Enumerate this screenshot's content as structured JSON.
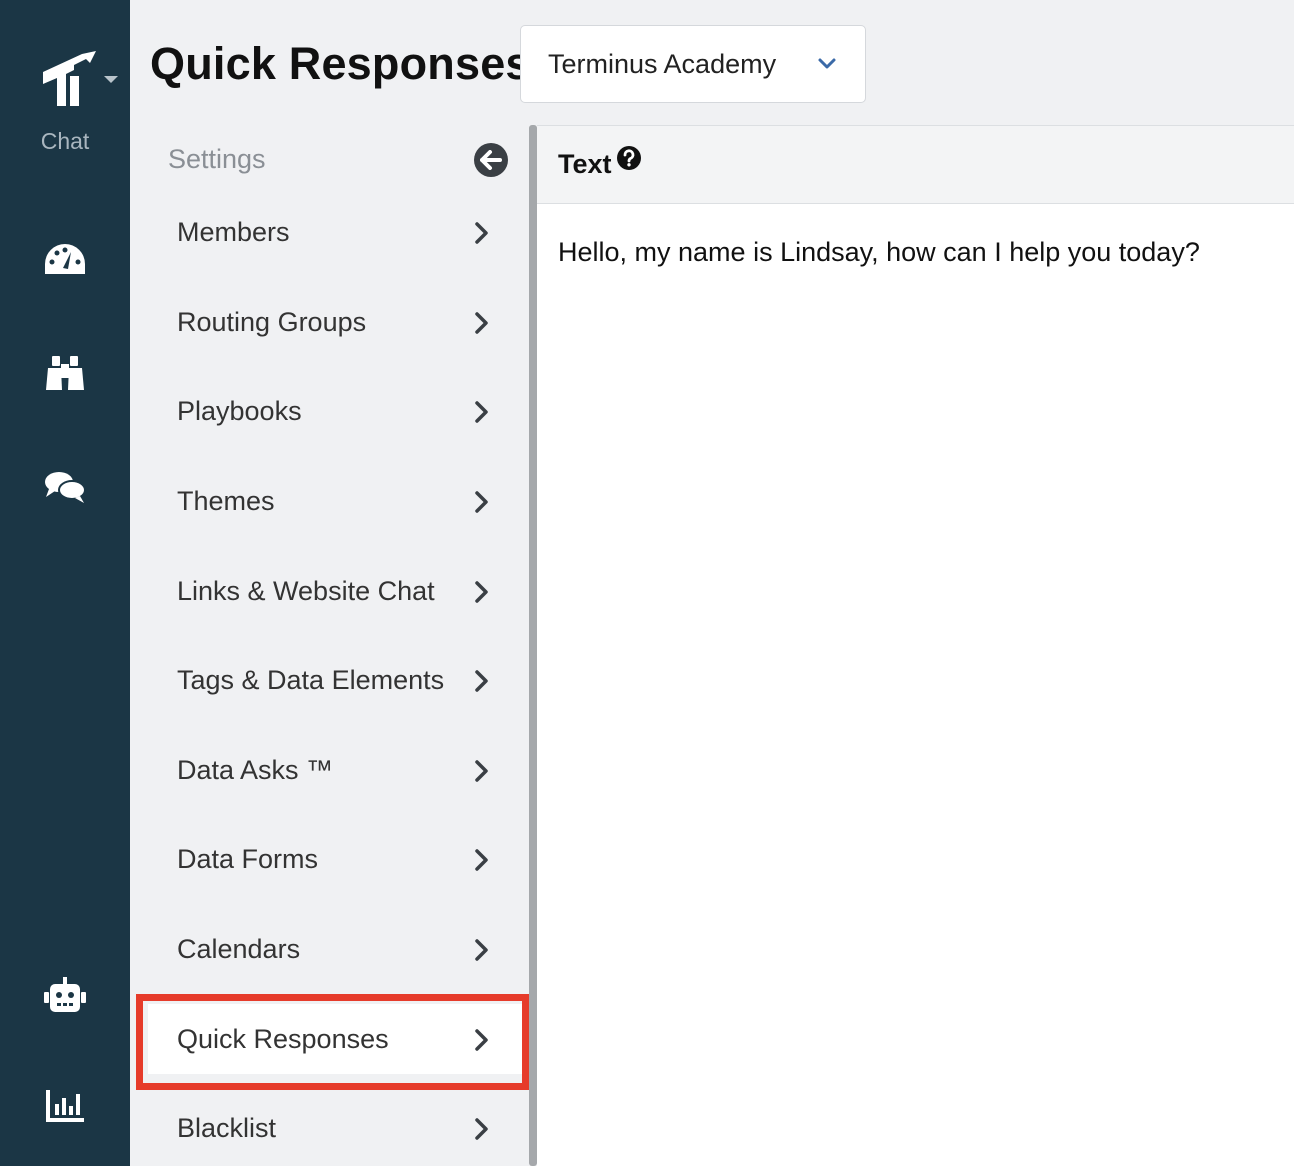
{
  "rail": {
    "app_label": "Chat",
    "icons": [
      "logo-icon",
      "dashboard-icon",
      "binoculars-icon",
      "chat-icon",
      "robot-icon",
      "bar-chart-icon"
    ]
  },
  "header": {
    "title": "Quick Responses",
    "org_select": {
      "value": "Terminus Academy"
    }
  },
  "settings_menu": {
    "title": "Settings",
    "items": [
      {
        "label": "Members"
      },
      {
        "label": "Routing Groups"
      },
      {
        "label": "Playbooks"
      },
      {
        "label": "Themes"
      },
      {
        "label": "Links & Website Chat"
      },
      {
        "label": "Tags & Data Elements"
      },
      {
        "label": "Data Asks ™"
      },
      {
        "label": "Data Forms"
      },
      {
        "label": "Calendars"
      },
      {
        "label": "Quick Responses"
      },
      {
        "label": "Blacklist"
      }
    ],
    "active_item": "Quick Responses"
  },
  "panel": {
    "column_label": "Text",
    "rows": [
      {
        "text": "Hello, my name is Lindsay, how can I help you today?"
      }
    ]
  },
  "colors": {
    "rail_bg": "#1b3645",
    "highlight": "#e63b2a"
  }
}
